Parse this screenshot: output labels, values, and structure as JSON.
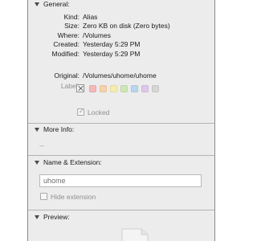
{
  "general": {
    "title": "General:",
    "rows": [
      {
        "label": "Kind:",
        "value": "Alias"
      },
      {
        "label": "Size:",
        "value": "Zero KB on disk (Zero bytes)"
      },
      {
        "label": "Where:",
        "value": "/Volumes"
      },
      {
        "label": "Created:",
        "value": "Yesterday 5:29 PM"
      },
      {
        "label": "Modified:",
        "value": "Yesterday 5:29 PM"
      }
    ],
    "original_label": "Original:",
    "original_value": "/Volumes/uhome/uhome",
    "label_label": "Label:",
    "label_colors": [
      "#f5b8b8",
      "#f7d2a8",
      "#f6ecae",
      "#cde8b4",
      "#b9d6f0",
      "#ddc8ea",
      "#d6d6d6"
    ],
    "locked_label": "Locked",
    "locked_checked": true
  },
  "more_info": {
    "title": "More Info:",
    "content": "--"
  },
  "name_extension": {
    "title": "Name & Extension:",
    "name_value": "uhome",
    "hide_extension_label": "Hide extension",
    "hide_extension_checked": false
  },
  "preview": {
    "title": "Preview:"
  }
}
